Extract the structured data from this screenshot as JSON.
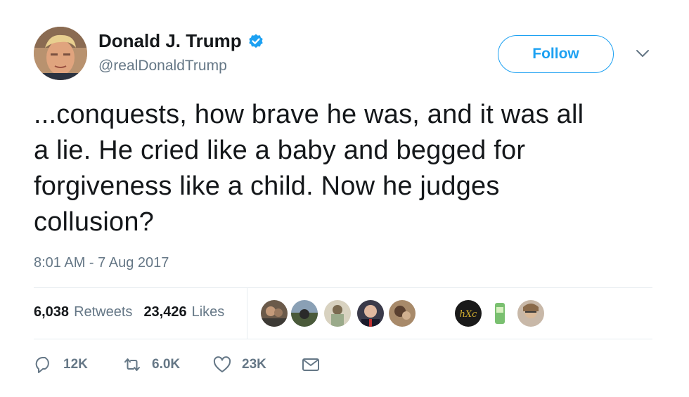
{
  "user": {
    "display_name": "Donald J. Trump",
    "handle": "@realDonaldTrump",
    "verified": true,
    "verified_icon": "verified-badge-icon"
  },
  "follow_label": "Follow",
  "tweet": {
    "lines": [
      "...conquests, how brave he was, and it was all",
      "a lie. He cried like a baby and begged for",
      "forgiveness like a child. Now he judges",
      "collusion?"
    ],
    "timestamp": "8:01 AM - 7 Aug 2017"
  },
  "stats": {
    "retweets_count": "6,038",
    "retweets_label": "Retweets",
    "likes_count": "23,426",
    "likes_label": "Likes"
  },
  "likers": [
    {
      "name": "liker-avatar-1"
    },
    {
      "name": "liker-avatar-2"
    },
    {
      "name": "liker-avatar-3"
    },
    {
      "name": "liker-avatar-4"
    },
    {
      "name": "liker-avatar-5"
    },
    {
      "name": "liker-avatar-6",
      "label": "hXc"
    },
    {
      "name": "liker-avatar-7"
    },
    {
      "name": "liker-avatar-8"
    }
  ],
  "actions": {
    "reply_count": "12K",
    "retweet_count": "6.0K",
    "like_count": "23K"
  },
  "colors": {
    "accent": "#1da1f2",
    "text": "#14171a",
    "muted": "#657786",
    "divider": "#e6ecf0"
  }
}
